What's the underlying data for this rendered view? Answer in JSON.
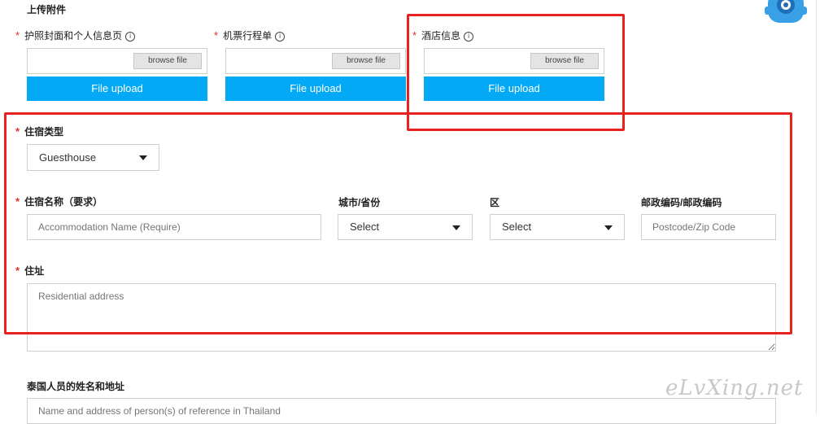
{
  "attachments": {
    "title": "上传附件",
    "items": [
      {
        "label": "护照封面和个人信息页",
        "browse": "browse file",
        "upload": "File upload"
      },
      {
        "label": "机票行程单",
        "browse": "browse file",
        "upload": "File upload"
      },
      {
        "label": "酒店信息",
        "browse": "browse file",
        "upload": "File upload"
      }
    ]
  },
  "required_mark": "*",
  "info_glyph": "i",
  "accommodation": {
    "type_label": "住宿类型",
    "type_value": "Guesthouse",
    "name_label": "住宿名称（要求）",
    "name_placeholder": "Accommodation Name (Require)",
    "city_label": "城市/省份",
    "city_value": "Select",
    "district_label": "区",
    "district_value": "Select",
    "postcode_label": "邮政编码/邮政编码",
    "postcode_placeholder": "Postcode/Zip Code",
    "address_label": "住址",
    "address_placeholder": "Residential address"
  },
  "reference": {
    "label": "泰国人员的姓名和地址",
    "placeholder": "Name and address of person(s) of reference in Thailand"
  },
  "watermark": "eLvXing.net",
  "colors": {
    "upload_blue": "#03a9f4",
    "annotation_red": "#e8231f",
    "required_red": "#e0302b"
  },
  "icons": {
    "mascot": "robot-mascot-icon",
    "dropdown": "caret-down-icon",
    "info": "info-circle-icon"
  }
}
